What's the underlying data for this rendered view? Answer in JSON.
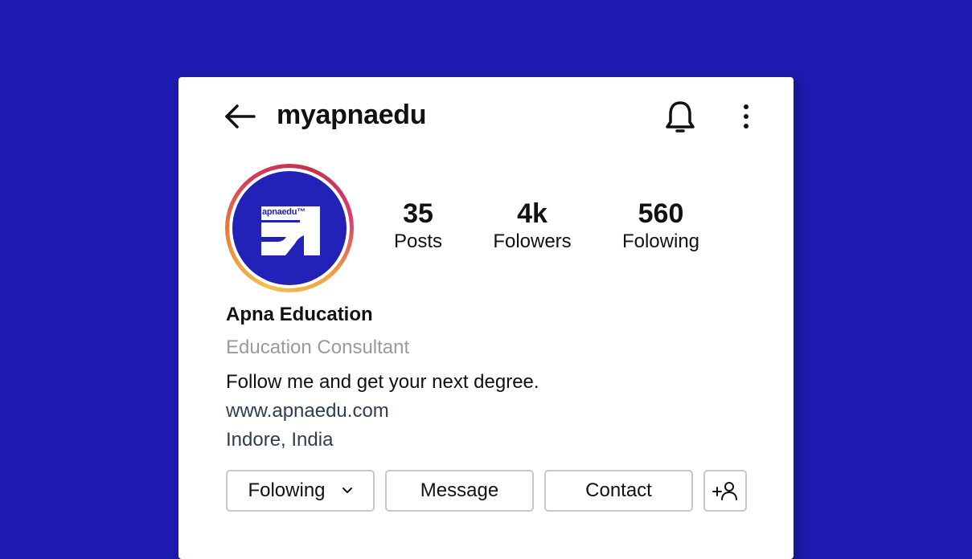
{
  "header": {
    "username": "myapnaedu"
  },
  "avatar": {
    "logo_text": "apnaedu™"
  },
  "stats": [
    {
      "value": "35",
      "label": "Posts"
    },
    {
      "value": "4k",
      "label": "Folowers"
    },
    {
      "value": "560",
      "label": "Folowing"
    }
  ],
  "profile": {
    "name": "Apna Education",
    "category": "Education Consultant",
    "bio": "Follow me and get your next degree.",
    "website": "www.apnaedu.com",
    "location": "Indore, India"
  },
  "actions": {
    "following_label": "Folowing",
    "message_label": "Message",
    "contact_label": "Contact",
    "add_user_label": "+"
  },
  "icons": {
    "back": "arrow-left-icon",
    "bell": "bell-icon",
    "more": "more-vertical-icon",
    "chevron": "chevron-down-icon",
    "add_user": "add-user-icon"
  },
  "colors": {
    "background": "#1d1bb0",
    "brand": "#2222b8",
    "secondary_text": "#9a9a9a",
    "link_text": "#2e3e4e"
  }
}
